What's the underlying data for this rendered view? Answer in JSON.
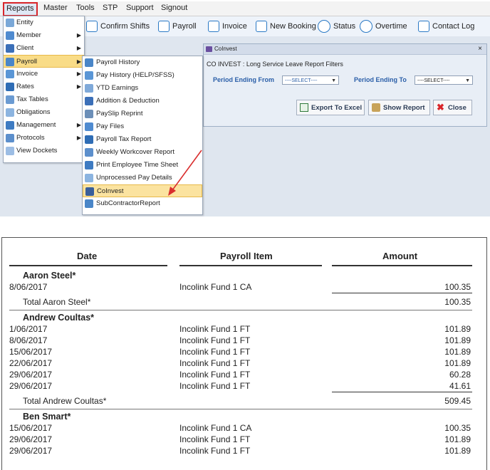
{
  "menubar": {
    "items": [
      "Reports",
      "Master",
      "Tools",
      "STP",
      "Support",
      "Signout"
    ]
  },
  "toolbar": {
    "items": [
      "Confirm Shifts",
      "Payroll",
      "Invoice",
      "New Booking",
      "Status",
      "Overtime",
      "Contact Log"
    ]
  },
  "reports_menu": {
    "items": [
      "Entity",
      "Member",
      "Client",
      "Payroll",
      "Invoice",
      "Rates",
      "Tax Tables",
      "Obligations",
      "Management",
      "Protocols",
      "View Dockets"
    ]
  },
  "payroll_menu": {
    "items": [
      "Payroll History",
      "Pay History (HELP/SFSS)",
      "YTD Earnings",
      "Addition & Deduction",
      "PaySlip Reprint",
      "Pay Files",
      "Payroll Tax Report",
      "Weekly Workcover Report",
      "Print Employee Time Sheet",
      "Unprocessed Pay Details",
      "CoInvest",
      "SubContractorReport"
    ]
  },
  "dialog": {
    "title": "CoInvest",
    "close": "×",
    "heading": "CO INVEST : Long Service Leave Report Filters",
    "from_label": "Period Ending From",
    "from_value": "----SELECT----",
    "to_label": "Period Ending To",
    "to_value": "----SELECT----",
    "export_label": "Export To Excel",
    "show_label": "Show Report",
    "close_label": "Close"
  },
  "report": {
    "headers": {
      "date": "Date",
      "item": "Payroll Item",
      "amount": "Amount"
    },
    "groups": [
      {
        "name": "Aaron Steel*",
        "rows": [
          {
            "date": "8/06/2017",
            "item": "Incolink Fund 1 CA",
            "amount": "100.35"
          }
        ],
        "total_label": "Total Aaron Steel*",
        "total": "100.35"
      },
      {
        "name": "Andrew Coultas*",
        "rows": [
          {
            "date": "1/06/2017",
            "item": "Incolink Fund 1 FT",
            "amount": "101.89"
          },
          {
            "date": "8/06/2017",
            "item": "Incolink Fund 1 FT",
            "amount": "101.89"
          },
          {
            "date": "15/06/2017",
            "item": "Incolink Fund 1 FT",
            "amount": "101.89"
          },
          {
            "date": "22/06/2017",
            "item": "Incolink Fund 1 FT",
            "amount": "101.89"
          },
          {
            "date": "29/06/2017",
            "item": "Incolink Fund 1 FT",
            "amount": "60.28"
          },
          {
            "date": "29/06/2017",
            "item": "Incolink Fund 1 FT",
            "amount": "41.61"
          }
        ],
        "total_label": "Total Andrew Coultas*",
        "total": "509.45"
      },
      {
        "name": "Ben Smart*",
        "rows": [
          {
            "date": "15/06/2017",
            "item": "Incolink Fund 1 CA",
            "amount": "100.35"
          },
          {
            "date": "29/06/2017",
            "item": "Incolink Fund 1 FT",
            "amount": "101.89"
          },
          {
            "date": "29/06/2017",
            "item": "Incolink Fund 1 FT",
            "amount": "101.89"
          }
        ]
      }
    ]
  }
}
